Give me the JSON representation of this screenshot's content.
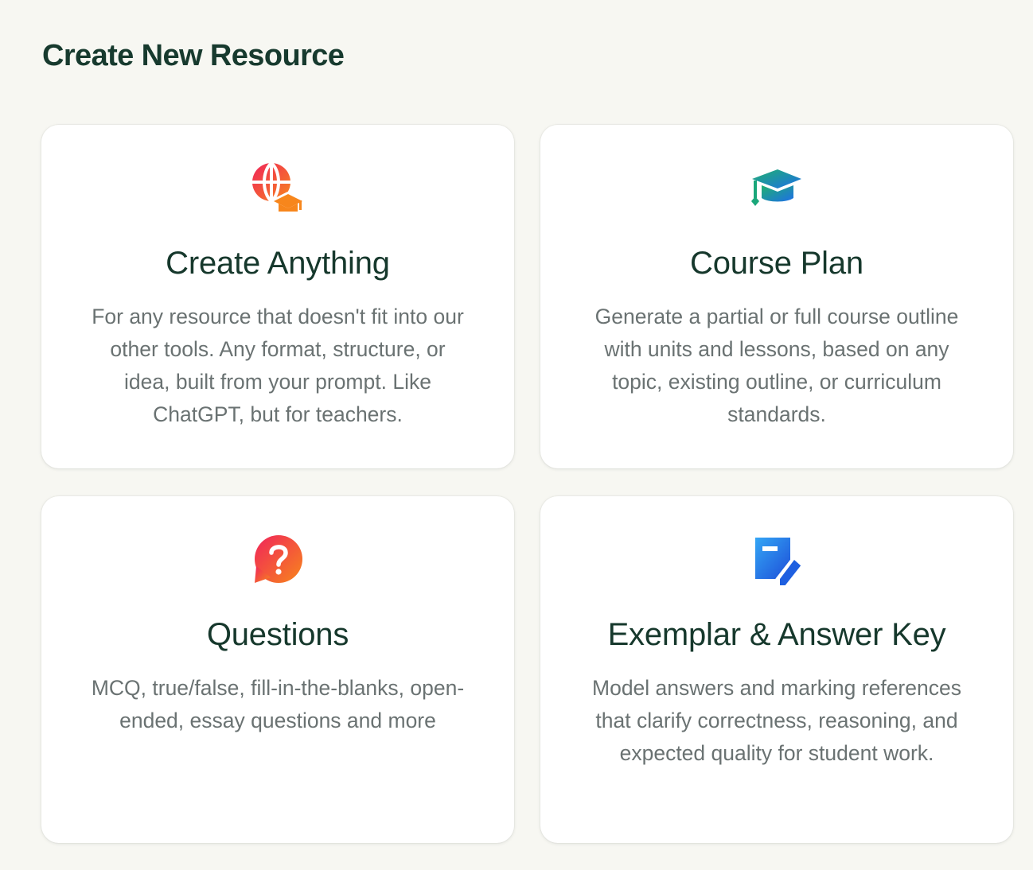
{
  "page": {
    "title": "Create New Resource"
  },
  "cards": [
    {
      "icon": "globe-graduation-cap-icon",
      "title": "Create Anything",
      "description": "For any resource that doesn't fit into our other tools. Any format, structure, or idea, built from your prompt. Like ChatGPT, but for teachers."
    },
    {
      "icon": "graduation-cap-icon",
      "title": "Course Plan",
      "description": "Generate a partial or full course outline with units and lessons, based on any topic, existing outline, or curriculum standards."
    },
    {
      "icon": "question-bubble-icon",
      "title": "Questions",
      "description": "MCQ, true/false, fill-in-the-blanks, open-ended, essay questions and more"
    },
    {
      "icon": "document-edit-icon",
      "title": "Exemplar & Answer Key",
      "description": "Model answers and marking references that clarify correctness, reasoning, and expected quality for student work."
    }
  ],
  "colors": {
    "background": "#f7f7f2",
    "card": "#ffffff",
    "heading": "#16382c",
    "body_text": "#6a7272",
    "accent_red": "#f0245a",
    "accent_orange": "#f7861c",
    "accent_green": "#1aa77a",
    "accent_blue": "#1e6fe8"
  }
}
